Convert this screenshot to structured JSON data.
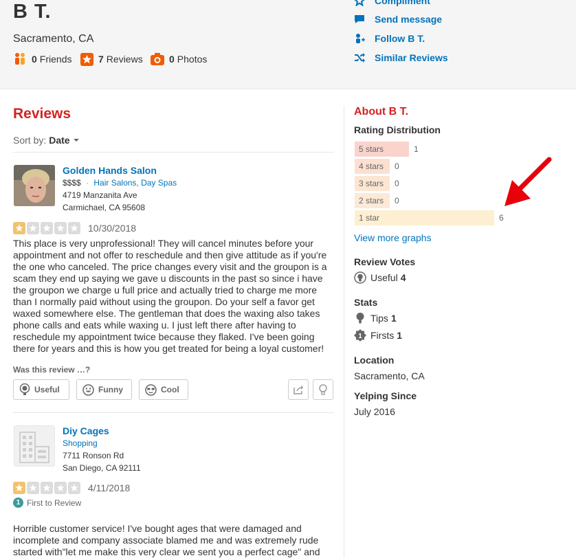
{
  "user": {
    "name": "B T.",
    "location": "Sacramento, CA",
    "stats": [
      {
        "count": "0",
        "label": "Friends"
      },
      {
        "count": "7",
        "label": "Reviews"
      },
      {
        "count": "0",
        "label": "Photos"
      }
    ]
  },
  "actions": {
    "compliment": "Compliment",
    "send_message": "Send message",
    "follow": "Follow B T.",
    "similar": "Similar Reviews"
  },
  "reviews": {
    "heading": "Reviews",
    "sort_label": "Sort by:",
    "sort_value": "Date",
    "items": [
      {
        "business": "Golden Hands Salon",
        "price": "$$$$",
        "categories": "Hair Salons, Day Spas",
        "address1": "4719 Manzanita Ave",
        "address2": "Carmichael, CA 95608",
        "rating": 1,
        "date": "10/30/2018",
        "text": "This place is very unprofessional! They will cancel minutes before your appointment and not offer to reschedule and then give attitude as if you're the one who canceled. The price changes every visit and the groupon is a scam they end up saying we gave u discounts in the past so since i have the groupon we charge u full price and actually tried to charge me more than I normally paid without using the groupon. Do your self a favor get waxed somewhere else. The gentleman that does the waxing also takes phone calls and eats while waxing u.  I just left there after having to reschedule my appointment twice because they flaked. I've been going there for years and this is how you get treated for being a loyal customer!"
      },
      {
        "business": "Diy Cages",
        "categories": "Shopping",
        "address1": "7711 Ronson Rd",
        "address2": "San Diego, CA 92111",
        "rating": 1,
        "date": "4/11/2018",
        "badge": "First to Review",
        "text": "Horrible customer service! I've bought ages that were damaged and incomplete and company associate blamed me and was extremely rude started with\"let me make this very clear we sent you a perfect cage\" and"
      }
    ],
    "was_helpful": "Was this review …?",
    "votes": {
      "useful": "Useful",
      "funny": "Funny",
      "cool": "Cool"
    }
  },
  "sidebar": {
    "about": "About B T.",
    "rating_distribution": "Rating Distribution",
    "distribution": [
      {
        "label": "5 stars",
        "count": "1",
        "color": "#f9d3cc"
      },
      {
        "label": "4 stars",
        "count": "0",
        "color": "#fbe0d1"
      },
      {
        "label": "3 stars",
        "count": "0",
        "color": "#fbe6d3"
      },
      {
        "label": "2 stars",
        "count": "0",
        "color": "#fcead6"
      },
      {
        "label": "1 star",
        "count": "6",
        "color": "#fdf0d2"
      }
    ],
    "view_more": "View more graphs",
    "review_votes_title": "Review Votes",
    "useful_label": "Useful",
    "useful_count": "4",
    "stats_title": "Stats",
    "tips_label": "Tips",
    "tips_count": "1",
    "firsts_label": "Firsts",
    "firsts_count": "1",
    "location_title": "Location",
    "location_value": "Sacramento, CA",
    "yelping_title": "Yelping Since",
    "yelping_value": "July 2016"
  },
  "colors": {
    "brand_red": "#d32323",
    "link_blue": "#0073bb",
    "star_orange": "#f0c370",
    "annotation_arrow": "#e8000b"
  }
}
